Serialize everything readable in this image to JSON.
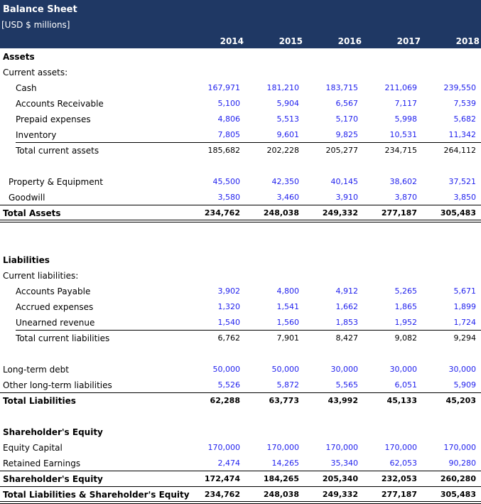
{
  "sheet": {
    "title": "Balance Sheet",
    "subtitle": "[USD $ millions]",
    "years": [
      "2014",
      "2015",
      "2016",
      "2017",
      "2018"
    ],
    "colors": {
      "header_bg": "#1f3864",
      "input_blue": "#2222ee",
      "text": "#000000"
    },
    "rows": [
      {
        "label": "Assets",
        "bold": true,
        "indent": 0
      },
      {
        "label": "Current assets:",
        "indent": 0
      },
      {
        "label": "Cash",
        "indent": 2,
        "color": "blue",
        "values": [
          "167,971",
          "181,210",
          "183,715",
          "211,069",
          "239,550"
        ]
      },
      {
        "label": "Accounts Receivable",
        "indent": 2,
        "color": "blue",
        "values": [
          "5,100",
          "5,904",
          "6,567",
          "7,117",
          "7,539"
        ]
      },
      {
        "label": "Prepaid expenses",
        "indent": 2,
        "color": "blue",
        "values": [
          "4,806",
          "5,513",
          "5,170",
          "5,998",
          "5,682"
        ]
      },
      {
        "label": "Inventory",
        "indent": 2,
        "color": "blue",
        "values": [
          "7,805",
          "9,601",
          "9,825",
          "10,531",
          "11,342"
        ],
        "line": "single-indent"
      },
      {
        "label": "Total current assets",
        "indent": 2,
        "color": "black",
        "values": [
          "185,682",
          "202,228",
          "205,277",
          "234,715",
          "264,112"
        ]
      },
      {
        "spacer": true
      },
      {
        "label": "Property & Equipment",
        "indent": 1,
        "color": "blue",
        "values": [
          "45,500",
          "42,350",
          "40,145",
          "38,602",
          "37,521"
        ]
      },
      {
        "label": "Goodwill",
        "indent": 1,
        "color": "blue",
        "values": [
          "3,580",
          "3,460",
          "3,910",
          "3,870",
          "3,850"
        ],
        "line": "single-full"
      },
      {
        "label": "Total Assets",
        "bold": true,
        "indent": 0,
        "color": "black",
        "values": [
          "234,762",
          "248,038",
          "249,332",
          "277,187",
          "305,483"
        ],
        "line": "double-full"
      },
      {
        "spacer": true
      },
      {
        "spacer": true
      },
      {
        "label": "Liabilities",
        "bold": true,
        "indent": 0
      },
      {
        "label": "Current liabilities:",
        "indent": 0
      },
      {
        "label": "Accounts Payable",
        "indent": 2,
        "color": "blue",
        "values": [
          "3,902",
          "4,800",
          "4,912",
          "5,265",
          "5,671"
        ]
      },
      {
        "label": "Accrued expenses",
        "indent": 2,
        "color": "blue",
        "values": [
          "1,320",
          "1,541",
          "1,662",
          "1,865",
          "1,899"
        ]
      },
      {
        "label": "Unearned revenue",
        "indent": 2,
        "color": "blue",
        "values": [
          "1,540",
          "1,560",
          "1,853",
          "1,952",
          "1,724"
        ],
        "line": "single-indent"
      },
      {
        "label": "Total current liabilities",
        "indent": 2,
        "color": "black",
        "values": [
          "6,762",
          "7,901",
          "8,427",
          "9,082",
          "9,294"
        ]
      },
      {
        "spacer": true
      },
      {
        "label": "Long-term debt",
        "indent": 0,
        "color": "blue",
        "values": [
          "50,000",
          "50,000",
          "30,000",
          "30,000",
          "30,000"
        ]
      },
      {
        "label": "Other long-term liabilities",
        "indent": 0,
        "color": "blue",
        "values": [
          "5,526",
          "5,872",
          "5,565",
          "6,051",
          "5,909"
        ],
        "line": "single-full"
      },
      {
        "label": "Total Liabilities",
        "bold": true,
        "indent": 0,
        "color": "black",
        "values": [
          "62,288",
          "63,773",
          "43,992",
          "45,133",
          "45,203"
        ]
      },
      {
        "spacer": true
      },
      {
        "label": "Shareholder's Equity",
        "bold": true,
        "indent": 0
      },
      {
        "label": "Equity Capital",
        "indent": 0,
        "color": "blue",
        "values": [
          "170,000",
          "170,000",
          "170,000",
          "170,000",
          "170,000"
        ]
      },
      {
        "label": "Retained Earnings",
        "indent": 0,
        "color": "blue",
        "values": [
          "2,474",
          "14,265",
          "35,340",
          "62,053",
          "90,280"
        ],
        "line": "single-full"
      },
      {
        "label": "Shareholder's Equity",
        "bold": true,
        "indent": 0,
        "color": "black",
        "values": [
          "172,474",
          "184,265",
          "205,340",
          "232,053",
          "260,280"
        ],
        "line": "single-full"
      },
      {
        "label": "Total Liabilities & Shareholder's Equity",
        "bold": true,
        "indent": 0,
        "color": "black",
        "values": [
          "234,762",
          "248,038",
          "249,332",
          "277,187",
          "305,483"
        ],
        "line": "double-full"
      }
    ]
  }
}
